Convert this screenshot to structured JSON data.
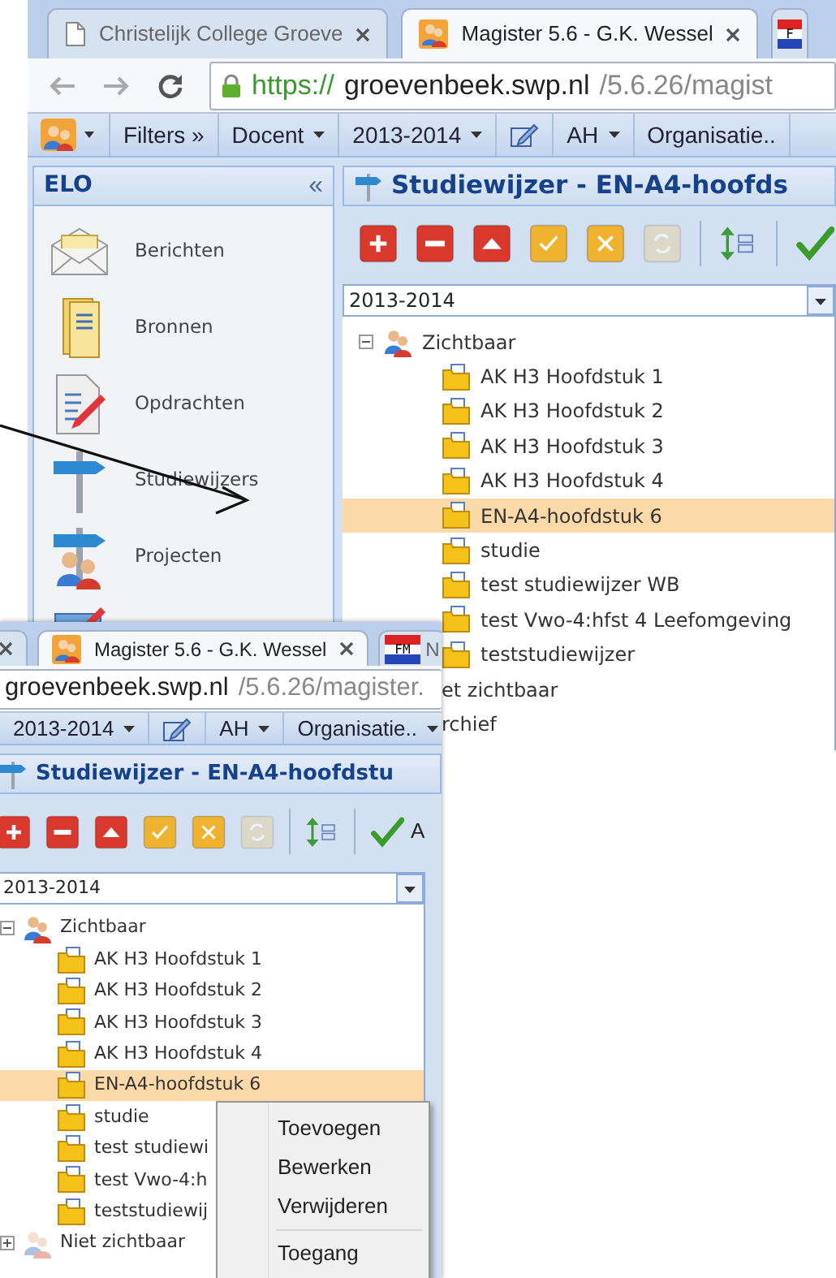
{
  "back_window": {
    "tabs": [
      {
        "label": "Christelijk College Groeve",
        "kind": "page",
        "selected": false
      },
      {
        "label": "Magister 5.6 - G.K. Wessel",
        "kind": "app",
        "selected": true
      },
      {
        "icon_text": "F",
        "kind": "flag",
        "selected": false
      }
    ],
    "address": {
      "scheme": "https://",
      "host": "groevenbeek.swp.nl",
      "path": "/5.6.26/magist"
    },
    "menu": [
      {
        "kind": "logo"
      },
      {
        "label": "Filters »",
        "kind": "plain"
      },
      {
        "label": "Docent",
        "kind": "dropdown"
      },
      {
        "label": "2013-2014",
        "kind": "dropdown"
      },
      {
        "kind": "edit"
      },
      {
        "label": "AH",
        "kind": "dropdown"
      },
      {
        "label": "Organisatie..",
        "kind": "plain"
      }
    ],
    "sidebar": {
      "title": "ELO",
      "collapse": "«",
      "items": [
        {
          "label": "Berichten",
          "kind": "messages"
        },
        {
          "label": "Bronnen",
          "kind": "sources"
        },
        {
          "label": "Opdrachten",
          "kind": "assignments"
        },
        {
          "label": "Studiewijzers",
          "kind": "guides"
        },
        {
          "label": "Projecten",
          "kind": "projects"
        }
      ]
    },
    "panel": {
      "title": "Studiewijzer - EN-A4-hoofds",
      "tools": [
        {
          "kind": "add",
          "disabled": false
        },
        {
          "kind": "remove",
          "disabled": false
        },
        {
          "kind": "up",
          "disabled": false
        },
        {
          "kind": "check",
          "disabled": false
        },
        {
          "kind": "cancel",
          "disabled": false
        },
        {
          "kind": "refresh",
          "disabled": true
        },
        {
          "kind": "tree",
          "disabled": false
        },
        {
          "kind": "accept",
          "disabled": false
        }
      ],
      "year": "2013-2014",
      "tree": [
        {
          "label": "Zichtbaar",
          "kind": "visible",
          "expanded": true,
          "selected": false,
          "children": [
            {
              "label": "AK H3 Hoofdstuk 1",
              "kind": "guide",
              "selected": false
            },
            {
              "label": "AK H3 Hoofdstuk 2",
              "kind": "guide",
              "selected": false
            },
            {
              "label": "AK H3 Hoofdstuk 3",
              "kind": "guide",
              "selected": false
            },
            {
              "label": "AK H3 Hoofdstuk 4",
              "kind": "guide",
              "selected": false
            },
            {
              "label": "EN-A4-hoofdstuk 6",
              "kind": "guide",
              "selected": true
            },
            {
              "label": "studie",
              "kind": "guide",
              "selected": false
            },
            {
              "label": "test studiewijzer WB",
              "kind": "guide",
              "selected": false
            },
            {
              "label": "test Vwo-4:hfst 4 Leefomgeving",
              "kind": "guide",
              "selected": false
            },
            {
              "label": "teststudiewijzer",
              "kind": "guide",
              "selected": false
            }
          ]
        },
        {
          "label": "et zichtbaar",
          "kind": "plain",
          "selected": false
        },
        {
          "label": "rchief",
          "kind": "plain",
          "selected": false
        }
      ]
    }
  },
  "front_window": {
    "tabs": [
      {
        "kind": "partial",
        "selected": false
      },
      {
        "label": "Magister 5.6 - G.K. Wessel",
        "kind": "app",
        "selected": true
      },
      {
        "icon_text": "FM",
        "label": "N",
        "kind": "flag",
        "selected": false
      }
    ],
    "address": {
      "host": "groevenbeek.swp.nl",
      "path": "/5.6.26/magister."
    },
    "menu": [
      {
        "label": "2013-2014",
        "kind": "dropdown"
      },
      {
        "kind": "edit"
      },
      {
        "label": "AH",
        "kind": "dropdown"
      },
      {
        "label": "Organisatie..",
        "kind": "dropdown"
      }
    ],
    "panel": {
      "title": "Studiewijzer - EN-A4-hoofdstu",
      "tools": [
        {
          "kind": "add",
          "disabled": false
        },
        {
          "kind": "remove",
          "disabled": false
        },
        {
          "kind": "up",
          "disabled": false
        },
        {
          "kind": "check",
          "disabled": false
        },
        {
          "kind": "cancel",
          "disabled": false
        },
        {
          "kind": "refresh",
          "disabled": true
        },
        {
          "kind": "tree",
          "disabled": false
        },
        {
          "kind": "accept",
          "label": "A",
          "disabled": false
        }
      ],
      "year": "2013-2014",
      "tree": [
        {
          "label": "Zichtbaar",
          "kind": "visible",
          "expanded": true,
          "selected": false,
          "children": [
            {
              "label": "AK H3 Hoofdstuk 1",
              "kind": "guide",
              "selected": false
            },
            {
              "label": "AK H3 Hoofdstuk 2",
              "kind": "guide",
              "selected": false
            },
            {
              "label": "AK H3 Hoofdstuk 3",
              "kind": "guide",
              "selected": false
            },
            {
              "label": "AK H3 Hoofdstuk 4",
              "kind": "guide",
              "selected": false
            },
            {
              "label": "EN-A4-hoofdstuk 6",
              "kind": "guide",
              "selected": true
            },
            {
              "label": "studie",
              "kind": "guide",
              "selected": false
            },
            {
              "label": "test studiewi",
              "kind": "guide",
              "selected": false
            },
            {
              "label": "test Vwo-4:h",
              "kind": "guide",
              "selected": false
            },
            {
              "label": "teststudiewij",
              "kind": "guide",
              "selected": false
            }
          ]
        },
        {
          "label": "Niet zichtbaar",
          "kind": "hidden",
          "expanded": false,
          "selected": false
        }
      ]
    },
    "context_menu": {
      "items": [
        {
          "kind": "item",
          "label": "Toevoegen"
        },
        {
          "kind": "item",
          "label": "Bewerken"
        },
        {
          "kind": "item",
          "label": "Verwijderen"
        },
        {
          "kind": "separator"
        },
        {
          "kind": "item",
          "label": "Toegang"
        }
      ]
    }
  }
}
